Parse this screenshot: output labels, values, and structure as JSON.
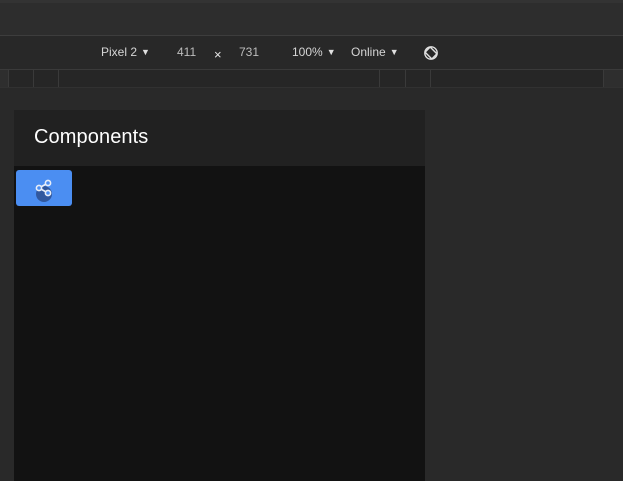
{
  "device_toolbar": {
    "device": "Pixel 2",
    "width": "411",
    "times": "×",
    "height": "731",
    "zoom": "100%",
    "network": "Online",
    "rotate_icon": "rotate-icon"
  },
  "app": {
    "title": "Components",
    "share_icon": "share-icon",
    "accent": "#4b8ef2"
  }
}
